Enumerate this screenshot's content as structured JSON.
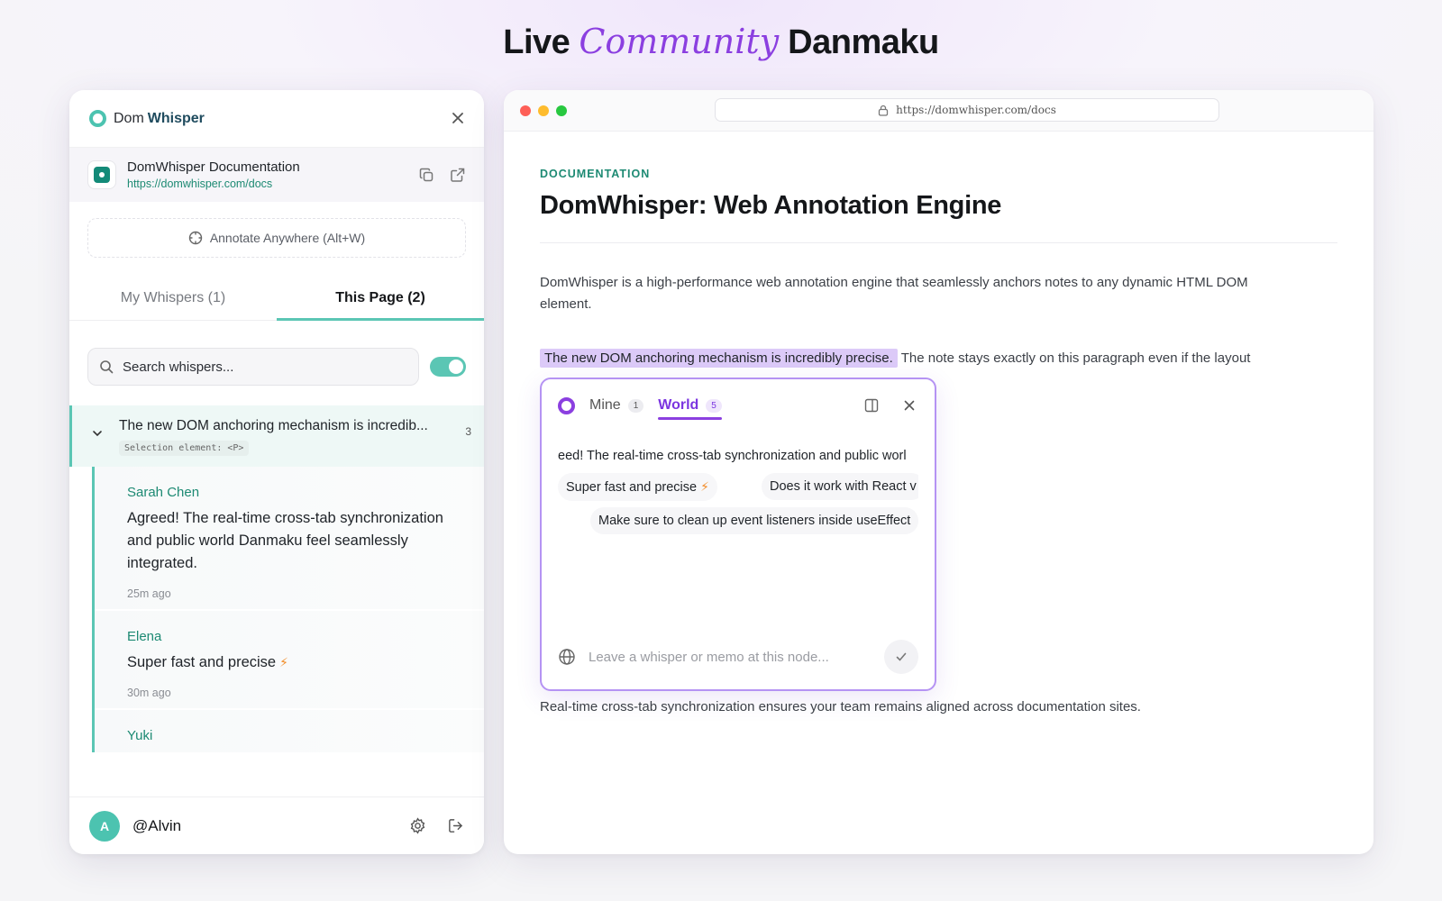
{
  "headline": {
    "part1": "Live",
    "accent": "Community",
    "part2": "Danmaku"
  },
  "colors": {
    "teal": "#5bc6b4",
    "purple": "#8b3fe0",
    "highlight": "#dccaf8"
  },
  "panel": {
    "brand_dom": "Dom",
    "brand_whisper": "Whisper",
    "site": {
      "title": "DomWhisper Documentation",
      "url": "https://domwhisper.com/docs"
    },
    "annotate_label": "Annotate Anywhere (Alt+W)",
    "tabs": [
      {
        "label": "My Whispers (1)"
      },
      {
        "label": "This Page (2)"
      }
    ],
    "search_placeholder": "Search whispers...",
    "thread": {
      "title": "The new DOM anchoring mechanism is incredib...",
      "selection": "Selection element: <P>",
      "count": "3"
    },
    "replies": [
      {
        "author": "Sarah Chen",
        "text": "Agreed! The real-time cross-tab synchronization and public world Danmaku feel seamlessly integrated.",
        "time": "25m ago"
      },
      {
        "author": "Elena",
        "text": "Super fast and precise",
        "time": "30m ago"
      },
      {
        "author": "Yuki"
      }
    ],
    "user": {
      "initial": "A",
      "handle": "@Alvin"
    }
  },
  "browser": {
    "url": "https://domwhisper.com/docs",
    "kicker": "DOCUMENTATION",
    "title": "DomWhisper: Web Annotation Engine",
    "para1": "DomWhisper is a high-performance web annotation engine that seamlessly anchors notes to any dynamic HTML DOM element.",
    "highlight": "The new DOM anchoring mechanism is incredibly precise.",
    "para2_rest": "The note stays exactly on this paragraph even if the layout",
    "para3": "Real-time cross-tab synchronization ensures your team remains aligned across documentation sites."
  },
  "popover": {
    "tabs": [
      {
        "label": "Mine",
        "count": "1"
      },
      {
        "label": "World",
        "count": "5"
      }
    ],
    "danmaku": [
      "eed! The real-time cross-tab synchronization and public worl",
      "Super fast and precise",
      "Does it work with React v",
      "Make sure to clean up event listeners inside useEffect"
    ],
    "input_placeholder": "Leave a whisper or memo at this node..."
  }
}
